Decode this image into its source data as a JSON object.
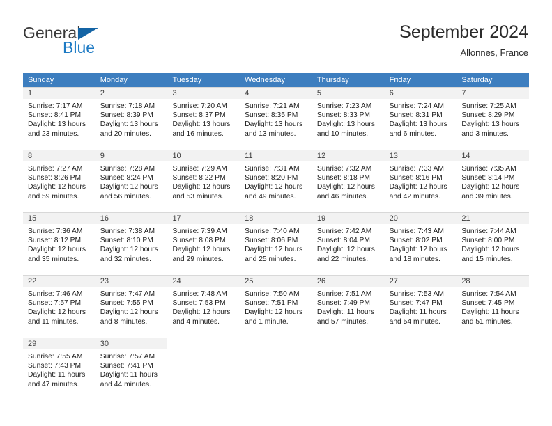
{
  "brand": {
    "name_part1": "General",
    "name_part2": "Blue",
    "triangle_icon": "triangle-icon",
    "color_blue": "#1d7ac4",
    "color_triangle": "#1464a5"
  },
  "header": {
    "title": "September 2024",
    "subtitle": "Allonnes, France"
  },
  "calendar": {
    "header_bg": "#3d7ebf",
    "weekdays": [
      "Sunday",
      "Monday",
      "Tuesday",
      "Wednesday",
      "Thursday",
      "Friday",
      "Saturday"
    ],
    "weeks": [
      [
        {
          "day": "1",
          "sunrise": "Sunrise: 7:17 AM",
          "sunset": "Sunset: 8:41 PM",
          "daylight1": "Daylight: 13 hours",
          "daylight2": "and 23 minutes."
        },
        {
          "day": "2",
          "sunrise": "Sunrise: 7:18 AM",
          "sunset": "Sunset: 8:39 PM",
          "daylight1": "Daylight: 13 hours",
          "daylight2": "and 20 minutes."
        },
        {
          "day": "3",
          "sunrise": "Sunrise: 7:20 AM",
          "sunset": "Sunset: 8:37 PM",
          "daylight1": "Daylight: 13 hours",
          "daylight2": "and 16 minutes."
        },
        {
          "day": "4",
          "sunrise": "Sunrise: 7:21 AM",
          "sunset": "Sunset: 8:35 PM",
          "daylight1": "Daylight: 13 hours",
          "daylight2": "and 13 minutes."
        },
        {
          "day": "5",
          "sunrise": "Sunrise: 7:23 AM",
          "sunset": "Sunset: 8:33 PM",
          "daylight1": "Daylight: 13 hours",
          "daylight2": "and 10 minutes."
        },
        {
          "day": "6",
          "sunrise": "Sunrise: 7:24 AM",
          "sunset": "Sunset: 8:31 PM",
          "daylight1": "Daylight: 13 hours",
          "daylight2": "and 6 minutes."
        },
        {
          "day": "7",
          "sunrise": "Sunrise: 7:25 AM",
          "sunset": "Sunset: 8:29 PM",
          "daylight1": "Daylight: 13 hours",
          "daylight2": "and 3 minutes."
        }
      ],
      [
        {
          "day": "8",
          "sunrise": "Sunrise: 7:27 AM",
          "sunset": "Sunset: 8:26 PM",
          "daylight1": "Daylight: 12 hours",
          "daylight2": "and 59 minutes."
        },
        {
          "day": "9",
          "sunrise": "Sunrise: 7:28 AM",
          "sunset": "Sunset: 8:24 PM",
          "daylight1": "Daylight: 12 hours",
          "daylight2": "and 56 minutes."
        },
        {
          "day": "10",
          "sunrise": "Sunrise: 7:29 AM",
          "sunset": "Sunset: 8:22 PM",
          "daylight1": "Daylight: 12 hours",
          "daylight2": "and 53 minutes."
        },
        {
          "day": "11",
          "sunrise": "Sunrise: 7:31 AM",
          "sunset": "Sunset: 8:20 PM",
          "daylight1": "Daylight: 12 hours",
          "daylight2": "and 49 minutes."
        },
        {
          "day": "12",
          "sunrise": "Sunrise: 7:32 AM",
          "sunset": "Sunset: 8:18 PM",
          "daylight1": "Daylight: 12 hours",
          "daylight2": "and 46 minutes."
        },
        {
          "day": "13",
          "sunrise": "Sunrise: 7:33 AM",
          "sunset": "Sunset: 8:16 PM",
          "daylight1": "Daylight: 12 hours",
          "daylight2": "and 42 minutes."
        },
        {
          "day": "14",
          "sunrise": "Sunrise: 7:35 AM",
          "sunset": "Sunset: 8:14 PM",
          "daylight1": "Daylight: 12 hours",
          "daylight2": "and 39 minutes."
        }
      ],
      [
        {
          "day": "15",
          "sunrise": "Sunrise: 7:36 AM",
          "sunset": "Sunset: 8:12 PM",
          "daylight1": "Daylight: 12 hours",
          "daylight2": "and 35 minutes."
        },
        {
          "day": "16",
          "sunrise": "Sunrise: 7:38 AM",
          "sunset": "Sunset: 8:10 PM",
          "daylight1": "Daylight: 12 hours",
          "daylight2": "and 32 minutes."
        },
        {
          "day": "17",
          "sunrise": "Sunrise: 7:39 AM",
          "sunset": "Sunset: 8:08 PM",
          "daylight1": "Daylight: 12 hours",
          "daylight2": "and 29 minutes."
        },
        {
          "day": "18",
          "sunrise": "Sunrise: 7:40 AM",
          "sunset": "Sunset: 8:06 PM",
          "daylight1": "Daylight: 12 hours",
          "daylight2": "and 25 minutes."
        },
        {
          "day": "19",
          "sunrise": "Sunrise: 7:42 AM",
          "sunset": "Sunset: 8:04 PM",
          "daylight1": "Daylight: 12 hours",
          "daylight2": "and 22 minutes."
        },
        {
          "day": "20",
          "sunrise": "Sunrise: 7:43 AM",
          "sunset": "Sunset: 8:02 PM",
          "daylight1": "Daylight: 12 hours",
          "daylight2": "and 18 minutes."
        },
        {
          "day": "21",
          "sunrise": "Sunrise: 7:44 AM",
          "sunset": "Sunset: 8:00 PM",
          "daylight1": "Daylight: 12 hours",
          "daylight2": "and 15 minutes."
        }
      ],
      [
        {
          "day": "22",
          "sunrise": "Sunrise: 7:46 AM",
          "sunset": "Sunset: 7:57 PM",
          "daylight1": "Daylight: 12 hours",
          "daylight2": "and 11 minutes."
        },
        {
          "day": "23",
          "sunrise": "Sunrise: 7:47 AM",
          "sunset": "Sunset: 7:55 PM",
          "daylight1": "Daylight: 12 hours",
          "daylight2": "and 8 minutes."
        },
        {
          "day": "24",
          "sunrise": "Sunrise: 7:48 AM",
          "sunset": "Sunset: 7:53 PM",
          "daylight1": "Daylight: 12 hours",
          "daylight2": "and 4 minutes."
        },
        {
          "day": "25",
          "sunrise": "Sunrise: 7:50 AM",
          "sunset": "Sunset: 7:51 PM",
          "daylight1": "Daylight: 12 hours",
          "daylight2": "and 1 minute."
        },
        {
          "day": "26",
          "sunrise": "Sunrise: 7:51 AM",
          "sunset": "Sunset: 7:49 PM",
          "daylight1": "Daylight: 11 hours",
          "daylight2": "and 57 minutes."
        },
        {
          "day": "27",
          "sunrise": "Sunrise: 7:53 AM",
          "sunset": "Sunset: 7:47 PM",
          "daylight1": "Daylight: 11 hours",
          "daylight2": "and 54 minutes."
        },
        {
          "day": "28",
          "sunrise": "Sunrise: 7:54 AM",
          "sunset": "Sunset: 7:45 PM",
          "daylight1": "Daylight: 11 hours",
          "daylight2": "and 51 minutes."
        }
      ],
      [
        {
          "day": "29",
          "sunrise": "Sunrise: 7:55 AM",
          "sunset": "Sunset: 7:43 PM",
          "daylight1": "Daylight: 11 hours",
          "daylight2": "and 47 minutes."
        },
        {
          "day": "30",
          "sunrise": "Sunrise: 7:57 AM",
          "sunset": "Sunset: 7:41 PM",
          "daylight1": "Daylight: 11 hours",
          "daylight2": "and 44 minutes."
        },
        {
          "day": "",
          "sunrise": "",
          "sunset": "",
          "daylight1": "",
          "daylight2": ""
        },
        {
          "day": "",
          "sunrise": "",
          "sunset": "",
          "daylight1": "",
          "daylight2": ""
        },
        {
          "day": "",
          "sunrise": "",
          "sunset": "",
          "daylight1": "",
          "daylight2": ""
        },
        {
          "day": "",
          "sunrise": "",
          "sunset": "",
          "daylight1": "",
          "daylight2": ""
        },
        {
          "day": "",
          "sunrise": "",
          "sunset": "",
          "daylight1": "",
          "daylight2": ""
        }
      ]
    ]
  }
}
